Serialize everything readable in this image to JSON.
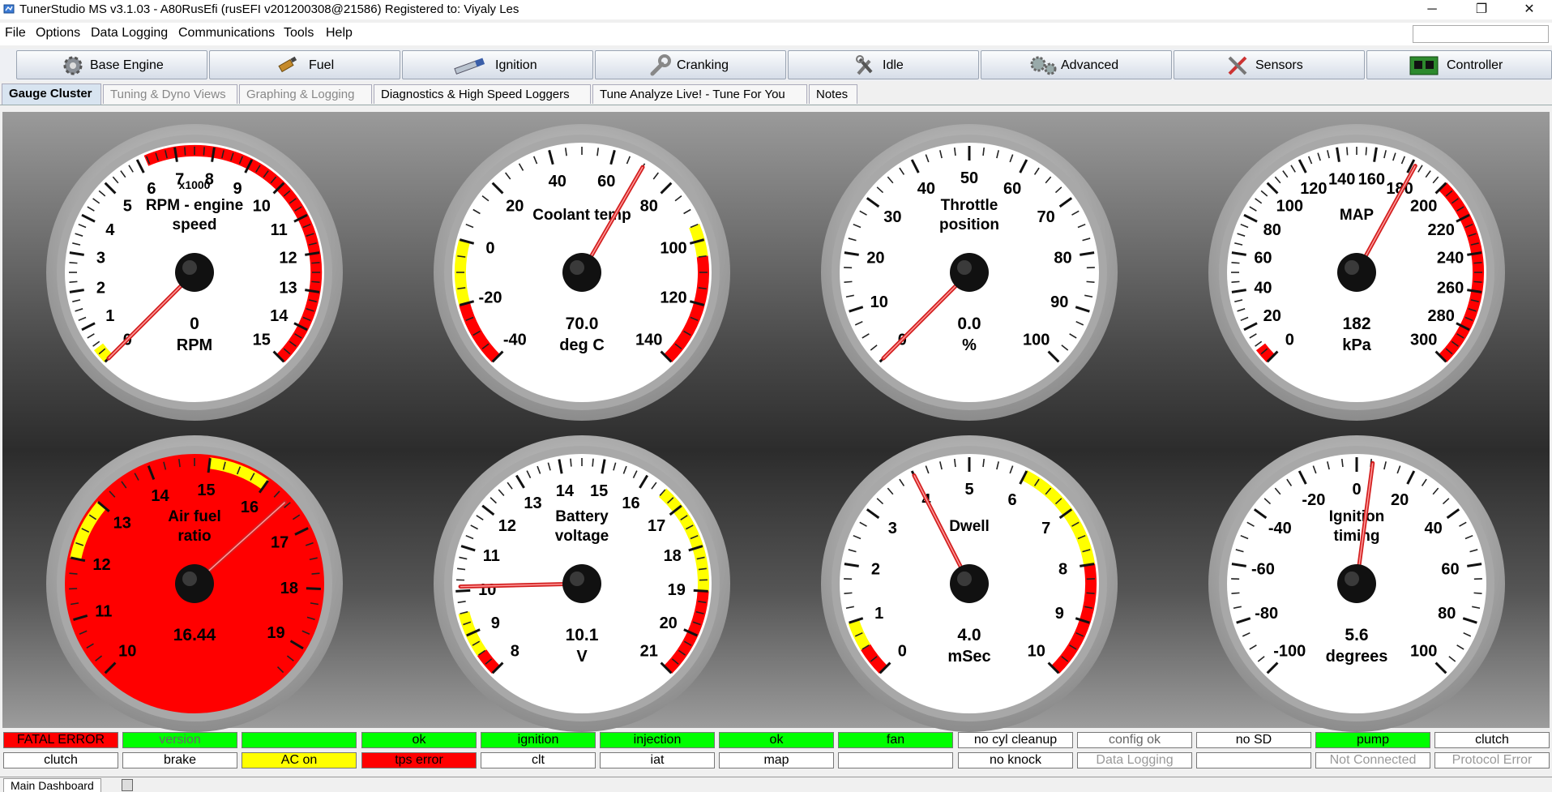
{
  "window": {
    "title": "TunerStudio MS v3.1.03 - A80RusEfi (rusEFI v201200308@21586) Registered to: Viyaly Les",
    "minimize": "─",
    "maximize": "❐",
    "close": "✕"
  },
  "menu": [
    "File",
    "Options",
    "Data Logging",
    "Communications",
    "Tools",
    "Help"
  ],
  "toolbar": [
    {
      "label": "Base Engine",
      "icon": "gear-icon"
    },
    {
      "label": "Fuel",
      "icon": "injector-icon"
    },
    {
      "label": "Ignition",
      "icon": "spark-plug-icon"
    },
    {
      "label": "Cranking",
      "icon": "wrench-icon"
    },
    {
      "label": "Idle",
      "icon": "tools-icon"
    },
    {
      "label": "Advanced",
      "icon": "gears-icon"
    },
    {
      "label": "Sensors",
      "icon": "screwdriver-wrench-icon"
    },
    {
      "label": "Controller",
      "icon": "circuit-board-icon"
    }
  ],
  "tabs": [
    {
      "label": "Gauge Cluster",
      "active": true,
      "dim": false
    },
    {
      "label": "Tuning & Dyno Views",
      "active": false,
      "dim": true
    },
    {
      "label": "Graphing & Logging",
      "active": false,
      "dim": true
    },
    {
      "label": "Diagnostics & High Speed Loggers",
      "active": false,
      "dim": false
    },
    {
      "label": "Tune Analyze Live! - Tune For You",
      "active": false,
      "dim": false
    },
    {
      "label": "Notes",
      "active": false,
      "dim": false
    }
  ],
  "gauges": [
    {
      "id": "rpm",
      "title": [
        "RPM - engine",
        "speed"
      ],
      "mult": "x1000",
      "value_text": "0",
      "units": "RPM",
      "min": 0,
      "max": 15,
      "labels": [
        "0",
        "1",
        "2",
        "3",
        "4",
        "5",
        "6",
        "7",
        "8",
        "9",
        "10",
        "11",
        "12",
        "13",
        "14",
        "15"
      ],
      "value": 0,
      "zones": [
        {
          "from": 0,
          "to": 0.4,
          "color": "#ffff00"
        },
        {
          "from": 6.2,
          "to": 15,
          "color": "#ff0000"
        }
      ],
      "face": "#ffffff"
    },
    {
      "id": "clt",
      "title": [
        "Coolant temp"
      ],
      "value_text": "70.0",
      "units": "deg C",
      "min": -40,
      "max": 140,
      "labels": [
        "-40",
        "-20",
        "0",
        "20",
        "40",
        "60",
        "80",
        "100",
        "120",
        "140"
      ],
      "value": 70,
      "zones": [
        {
          "from": -40,
          "to": -20,
          "color": "#ff0000"
        },
        {
          "from": -20,
          "to": 0,
          "color": "#ffff00"
        },
        {
          "from": 95,
          "to": 105,
          "color": "#ffff00"
        },
        {
          "from": 105,
          "to": 140,
          "color": "#ff0000"
        }
      ],
      "face": "#ffffff"
    },
    {
      "id": "tps",
      "title": [
        "Throttle",
        "position"
      ],
      "value_text": "0.0",
      "units": "%",
      "min": 0,
      "max": 100,
      "labels": [
        "0",
        "10",
        "20",
        "30",
        "40",
        "50",
        "60",
        "70",
        "80",
        "90",
        "100"
      ],
      "value": 0,
      "zones": [],
      "face": "#ffffff"
    },
    {
      "id": "map",
      "title": [
        "MAP"
      ],
      "value_text": "182",
      "units": "kPa",
      "min": 0,
      "max": 300,
      "labels": [
        "0",
        "20",
        "40",
        "60",
        "80",
        "100",
        "120",
        "140",
        "160",
        "180",
        "200",
        "220",
        "240",
        "260",
        "280",
        "300"
      ],
      "value": 182,
      "zones": [
        {
          "from": 0,
          "to": 8,
          "color": "#ff0000"
        },
        {
          "from": 200,
          "to": 300,
          "color": "#ff0000"
        }
      ],
      "face": "#ffffff"
    },
    {
      "id": "afr",
      "title": [
        "Air fuel",
        "ratio"
      ],
      "value_text": "16.44",
      "units": "",
      "min": 10,
      "max": 19.5,
      "labels": [
        "10",
        "11",
        "12",
        "13",
        "14",
        "15",
        "16",
        "17",
        "18",
        "19"
      ],
      "value": 16.44,
      "zones": [
        {
          "from": 12,
          "to": 13,
          "color": "#ffff00"
        },
        {
          "from": 15,
          "to": 16,
          "color": "#ffff00"
        }
      ],
      "face": "#ff0000"
    },
    {
      "id": "vbat",
      "title": [
        "Battery",
        "voltage"
      ],
      "value_text": "10.1",
      "units": "V",
      "min": 8,
      "max": 21,
      "labels": [
        "8",
        "9",
        "10",
        "11",
        "12",
        "13",
        "14",
        "15",
        "16",
        "17",
        "18",
        "19",
        "20",
        "21"
      ],
      "value": 10.1,
      "zones": [
        {
          "from": 8,
          "to": 8.5,
          "color": "#ff0000"
        },
        {
          "from": 8.5,
          "to": 9.5,
          "color": "#ffff00"
        },
        {
          "from": 16.5,
          "to": 19,
          "color": "#ffff00"
        },
        {
          "from": 19,
          "to": 21,
          "color": "#ff0000"
        }
      ],
      "face": "#ffffff"
    },
    {
      "id": "dwell",
      "title": [
        "Dwell"
      ],
      "value_text": "4.0",
      "units": "mSec",
      "min": 0,
      "max": 10,
      "labels": [
        "0",
        "1",
        "2",
        "3",
        "4",
        "5",
        "6",
        "7",
        "8",
        "9",
        "10"
      ],
      "value": 4,
      "zones": [
        {
          "from": 0,
          "to": 0.5,
          "color": "#ff0000"
        },
        {
          "from": 0.5,
          "to": 1,
          "color": "#ffff00"
        },
        {
          "from": 6,
          "to": 8,
          "color": "#ffff00"
        },
        {
          "from": 8,
          "to": 10,
          "color": "#ff0000"
        }
      ],
      "face": "#ffffff"
    },
    {
      "id": "timing",
      "title": [
        "Ignition",
        "timing"
      ],
      "value_text": "5.6",
      "units": "degrees",
      "min": -100,
      "max": 100,
      "labels": [
        "-100",
        "-80",
        "-60",
        "-40",
        "-20",
        "0",
        "20",
        "40",
        "60",
        "80",
        "100"
      ],
      "value": 5.6,
      "zones": [],
      "face": "#ffffff"
    }
  ],
  "indicators": [
    [
      {
        "text": "FATAL ERROR",
        "bg": "#ff0000",
        "fg": "#000000"
      },
      {
        "text": "version",
        "bg": "#00ff00",
        "fg": "#666666"
      },
      {
        "text": "",
        "bg": "#00ff00",
        "fg": "#000000"
      },
      {
        "text": "ok",
        "bg": "#00ff00",
        "fg": "#000000"
      },
      {
        "text": "ignition",
        "bg": "#00ff00",
        "fg": "#000000"
      },
      {
        "text": "injection",
        "bg": "#00ff00",
        "fg": "#000000"
      },
      {
        "text": "ok",
        "bg": "#00ff00",
        "fg": "#000000"
      },
      {
        "text": "fan",
        "bg": "#00ff00",
        "fg": "#000000"
      },
      {
        "text": "no cyl cleanup",
        "bg": "#ffffff",
        "fg": "#000000"
      },
      {
        "text": "config ok",
        "bg": "#ffffff",
        "fg": "#666666"
      },
      {
        "text": "no SD",
        "bg": "#ffffff",
        "fg": "#000000"
      },
      {
        "text": "pump",
        "bg": "#00ff00",
        "fg": "#000000"
      },
      {
        "text": "clutch",
        "bg": "#ffffff",
        "fg": "#000000"
      }
    ],
    [
      {
        "text": "clutch",
        "bg": "#ffffff",
        "fg": "#000000"
      },
      {
        "text": "brake",
        "bg": "#ffffff",
        "fg": "#000000"
      },
      {
        "text": "AC on",
        "bg": "#ffff00",
        "fg": "#000000"
      },
      {
        "text": "tps error",
        "bg": "#ff0000",
        "fg": "#000000"
      },
      {
        "text": "clt",
        "bg": "#ffffff",
        "fg": "#000000"
      },
      {
        "text": "iat",
        "bg": "#ffffff",
        "fg": "#000000"
      },
      {
        "text": "map",
        "bg": "#ffffff",
        "fg": "#000000"
      },
      {
        "text": "",
        "bg": "#ffffff",
        "fg": "#000000"
      },
      {
        "text": "no knock",
        "bg": "#ffffff",
        "fg": "#000000"
      },
      {
        "text": "Data Logging",
        "bg": "#ffffff",
        "fg": "#999999"
      },
      {
        "text": "",
        "bg": "#ffffff",
        "fg": "#000000"
      },
      {
        "text": "Not Connected",
        "bg": "#ffffff",
        "fg": "#999999"
      },
      {
        "text": "Protocol Error",
        "bg": "#ffffff",
        "fg": "#999999"
      }
    ]
  ],
  "bottom_tab": "Main Dashboard"
}
